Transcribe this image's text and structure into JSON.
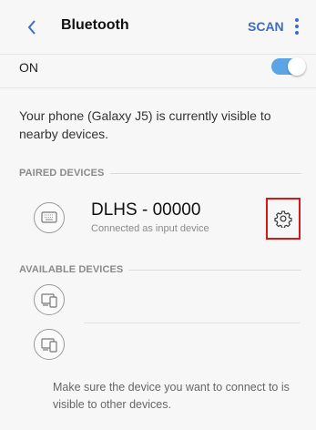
{
  "header": {
    "back_icon": "chevron-left-icon",
    "title": "Bluetooth",
    "scan_label": "SCAN",
    "more_icon": "more-vertical-icon",
    "accent_color": "#3b6ec4"
  },
  "bluetooth_toggle": {
    "label": "ON",
    "state": "on",
    "toggle_color": "#5ba4e6"
  },
  "visibility_message": "Your phone (Galaxy J5) is currently visible to nearby devices.",
  "paired_section": {
    "header": "PAIRED DEVICES",
    "devices": [
      {
        "icon": "keyboard-icon",
        "name": "DLHS - 00000",
        "status": "Connected as input device",
        "settings_icon": "gear-icon"
      }
    ]
  },
  "available_section": {
    "header": "AVAILABLE DEVICES",
    "devices": [
      {
        "icon": "devices-icon"
      },
      {
        "icon": "devices-icon"
      }
    ]
  },
  "hint": "Make sure the device you want to connect to is visible to other devices."
}
